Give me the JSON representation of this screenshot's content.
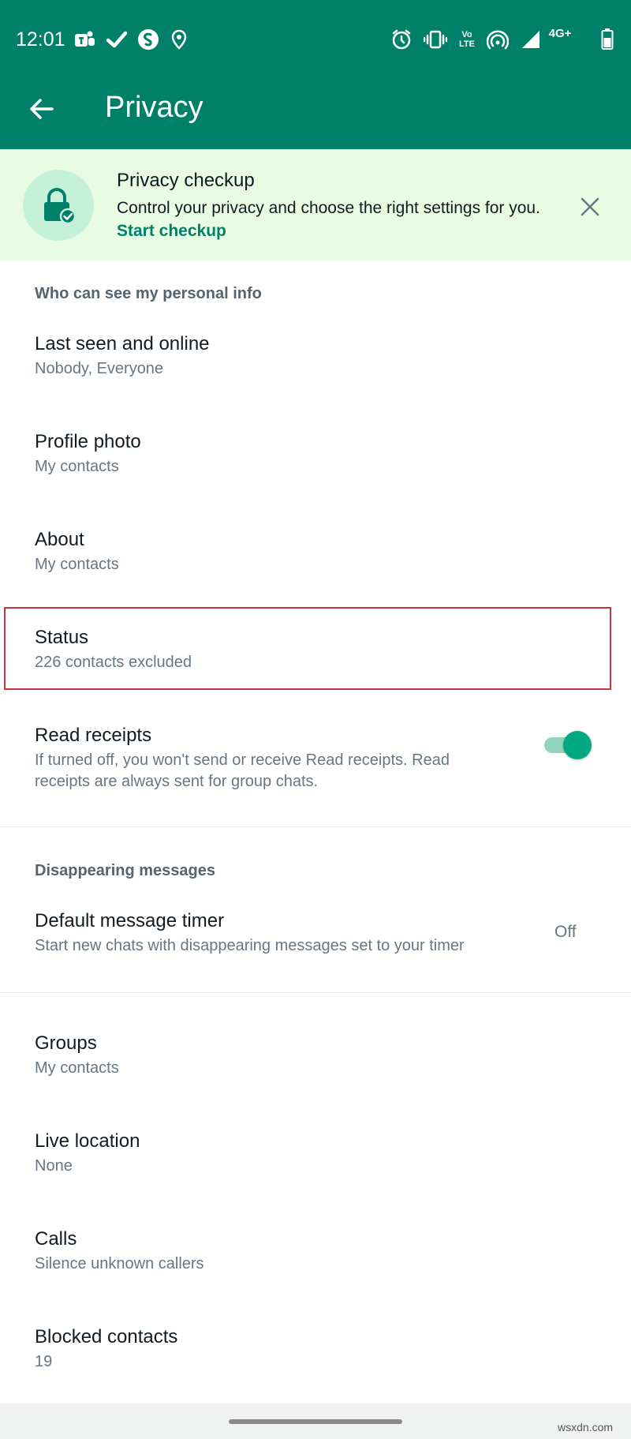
{
  "status_bar": {
    "time": "12:01",
    "network_label": "4G+",
    "volte_label_top": "Vo",
    "volte_label_bottom": "LTE",
    "left_icons": [
      "teams-icon",
      "check-icon",
      "shazam-icon",
      "location-pin-icon"
    ],
    "right_icons": [
      "alarm-icon",
      "vibrate-icon",
      "volte-icon",
      "hotspot-icon",
      "signal-icon",
      "network-4g-icon",
      "battery-icon"
    ]
  },
  "header": {
    "title": "Privacy",
    "back_icon": "arrow-back-icon"
  },
  "banner": {
    "title": "Privacy checkup",
    "description": "Control your privacy and choose the right settings for you.",
    "link": "Start checkup",
    "icon": "lock-check-icon",
    "close_icon": "close-icon"
  },
  "sections": {
    "personal_info_header": "Who can see my personal info",
    "disappearing_header": "Disappearing messages"
  },
  "items": {
    "last_seen": {
      "title": "Last seen and online",
      "value": "Nobody, Everyone"
    },
    "profile_photo": {
      "title": "Profile photo",
      "value": "My contacts"
    },
    "about": {
      "title": "About",
      "value": "My contacts"
    },
    "status": {
      "title": "Status",
      "value": "226 contacts excluded"
    },
    "read_receipts": {
      "title": "Read receipts",
      "description": "If turned off, you won't send or receive Read receipts. Read receipts are always sent for group chats.",
      "enabled": true
    },
    "default_timer": {
      "title": "Default message timer",
      "description": "Start new chats with disappearing messages set to your timer",
      "value": "Off"
    },
    "groups": {
      "title": "Groups",
      "value": "My contacts"
    },
    "live_location": {
      "title": "Live location",
      "value": "None"
    },
    "calls": {
      "title": "Calls",
      "value": "Silence unknown callers"
    },
    "blocked": {
      "title": "Blocked contacts",
      "value": "19"
    }
  },
  "watermark": "wsxdn.com",
  "colors": {
    "appbar": "#008069",
    "banner_bg": "#e7fce3",
    "accent": "#00a884",
    "highlight_border": "#c8343a"
  }
}
